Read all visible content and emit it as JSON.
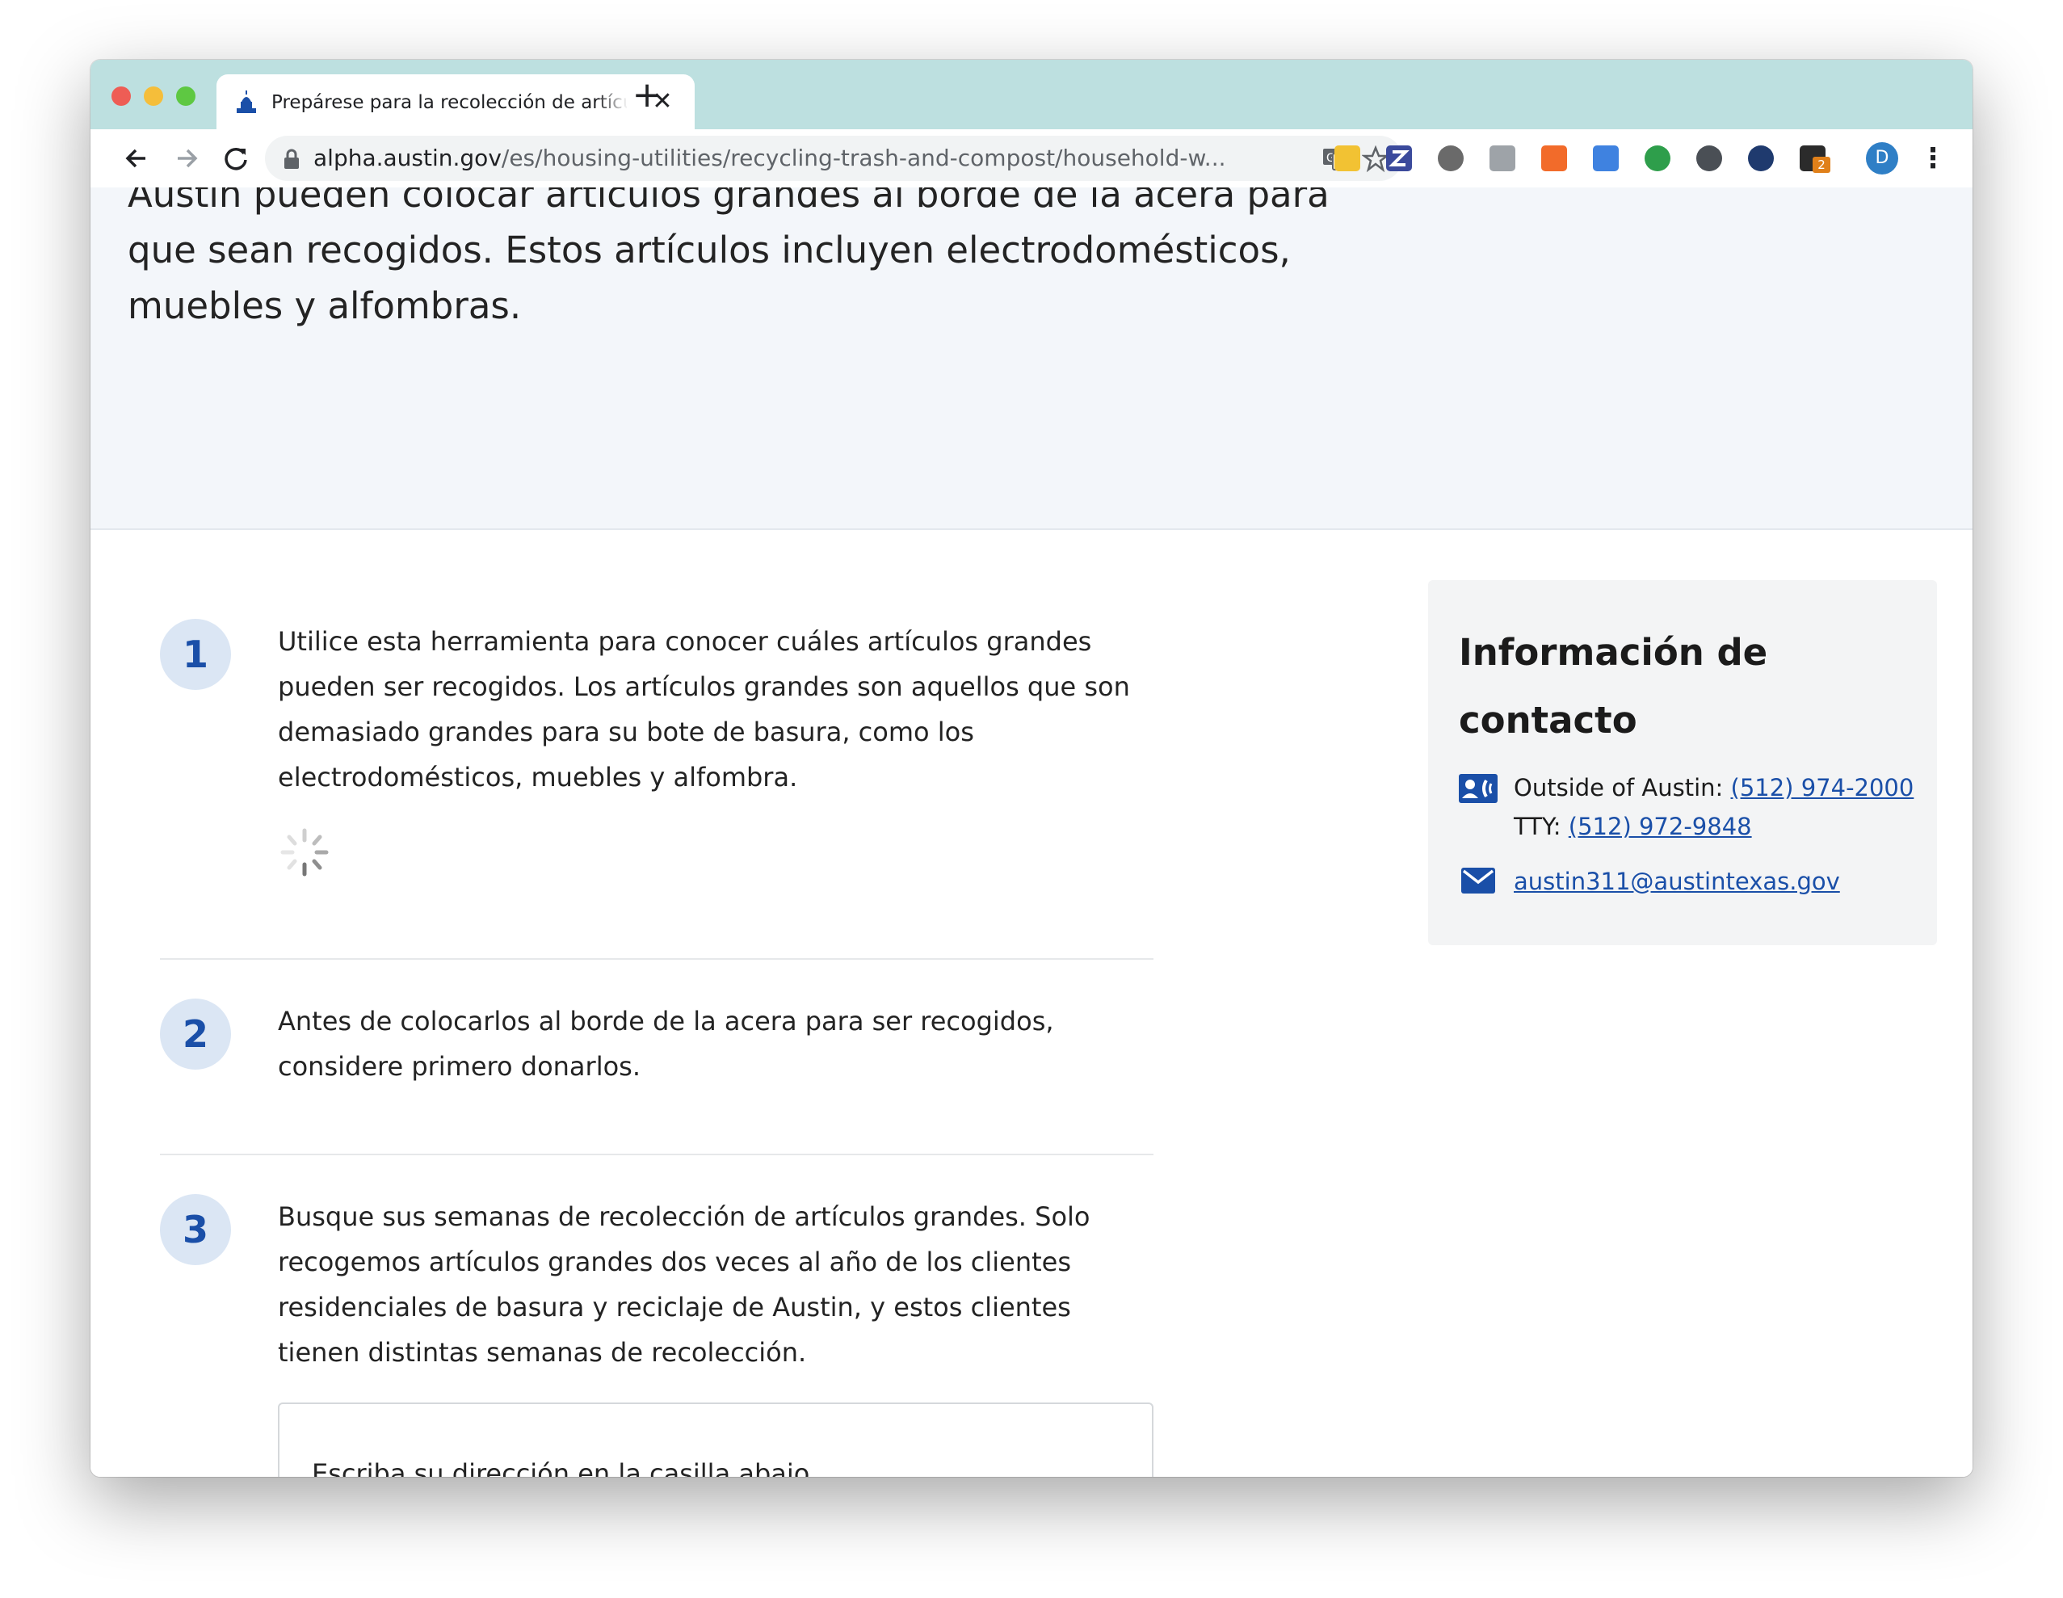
{
  "browser": {
    "tab_title": "Prepárese para la recolección de artículos grandes",
    "url_host": "alpha.austin.gov",
    "url_path": "/es/housing-utilities/recycling-trash-and-compost/household-w...",
    "profile_initial": "D",
    "extension_badge": "2"
  },
  "hero": {
    "text": "Austin pueden colocar artículos grandes al borde de la acera para que sean recogidos. Estos artículos incluyen electrodomésticos, muebles y alfombras."
  },
  "steps": [
    {
      "number": "1",
      "text": "Utilice esta herramienta para conocer cuáles artículos grandes pueden ser recogidos. Los artículos grandes son aquellos que son demasiado grandes para su bote de basura, como los electrodomésticos, muebles y alfombra."
    },
    {
      "number": "2",
      "text": "Antes de colocarlos al borde de la acera para ser recogidos, considere primero donarlos."
    },
    {
      "number": "3",
      "text": "Busque sus semanas de recolección de artículos grandes. Solo recogemos artículos grandes dos veces al año de los clientes residenciales de basura y reciclaje de Austin, y estos clientes tienen distintas semanas de recolección."
    }
  ],
  "address_form": {
    "label": "Escriba su dirección en la casilla abajo",
    "value": ""
  },
  "contact": {
    "title": "Información de contacto",
    "outside_label": "Outside of Austin:",
    "outside_phone": "(512) 974-2000",
    "tty_label": "TTY:",
    "tty_phone": "(512) 972-9848",
    "email": "austin311@austintexas.gov"
  },
  "colors": {
    "tab_strip": "#bde0e0",
    "accent_blue": "#1a4fa8",
    "step_circle": "#dbe6f4",
    "hero_bg": "#f3f6fa",
    "contact_bg": "#f3f4f5"
  }
}
